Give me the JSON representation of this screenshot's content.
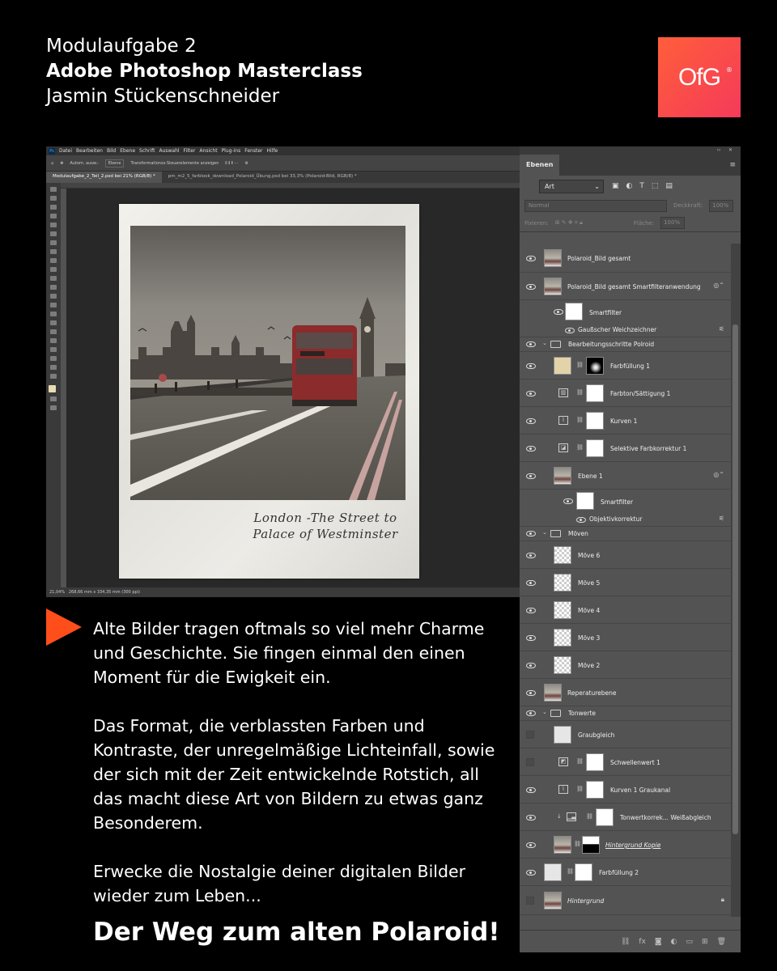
{
  "header": {
    "line1": "Modulaufgabe 2",
    "line2": "Adobe Photoshop Masterclass",
    "line3": "Jasmin Stückenschneider"
  },
  "logo": {
    "text": "OfG",
    "mark": "®",
    "color_start": "#ff5e3a",
    "color_end": "#f53a5a"
  },
  "photoshop": {
    "menu": [
      "Datei",
      "Bearbeiten",
      "Bild",
      "Ebene",
      "Schrift",
      "Auswahl",
      "Filter",
      "Ansicht",
      "Plug-ins",
      "Fenster",
      "Hilfe"
    ],
    "options": {
      "auto_select": "Autom. ausw.:",
      "auto_select_value": "Ebene",
      "transform": "Transformationss-Steuerelemente anzeigen"
    },
    "tabs": [
      "Modulaufgabe_2_Teil_2.psd bei 21% (RGB/8) *",
      "pm_m2_5_farblook_download_Polaroid_Übung.psd bei 33,3% (Polaroid-Bild, RGB/8) *"
    ],
    "status": {
      "zoom": "21,04%",
      "dimensions": "268,66 mm x 334,35 mm (300 ppi)"
    },
    "caption_line1": "London -The Street to",
    "caption_line2": "Palace of Westminster"
  },
  "body": {
    "p1": "Alte Bilder tragen oftmals so viel mehr Charme und Geschichte. Sie fingen einmal den einen Moment für die Ewigkeit ein.",
    "p2": "Das Format, die verblassten Farben und Kontraste, der unregelmäßige Lichteinfall, sowie der sich mit der Zeit entwickelnde Rotstich, all das macht diese Art von Bildern zu etwas ganz Besonderem.",
    "p3": "Erwecke die Nostalgie deiner digitalen Bilder wieder zum Leben...",
    "cta": "Der Weg zum alten Polaroid!",
    "accent": "#ff4e1a"
  },
  "layers_panel": {
    "tab": "Ebenen",
    "filter_kind": "Art",
    "blend_mode": "Normal",
    "opacity_label": "Deckkraft:",
    "opacity": "100%",
    "lock_label": "Fixieren:",
    "fill_label": "Fläche:",
    "fill": "100%",
    "layers": [
      {
        "name": "Polaroid_Bild gesamt"
      },
      {
        "name": "Polaroid_Bild gesamt Smartfilteranwendung"
      },
      {
        "name": "Smartfilter"
      },
      {
        "name": "Gaußscher Weichzeichner"
      },
      {
        "name": "Bearbeitungsschritte Polroid"
      },
      {
        "name": "Farbfüllung 1"
      },
      {
        "name": "Farbton/Sättigung 1"
      },
      {
        "name": "Kurven 1"
      },
      {
        "name": "Selektive Farbkorrektur 1"
      },
      {
        "name": "Ebene 1"
      },
      {
        "name": "Smartfilter"
      },
      {
        "name": "Objektivkorrektur"
      },
      {
        "name": "Möven"
      },
      {
        "name": "Möve 6"
      },
      {
        "name": "Möve 5"
      },
      {
        "name": "Möve 4"
      },
      {
        "name": "Möve 3"
      },
      {
        "name": "Möve 2"
      },
      {
        "name": "Reperaturebene"
      },
      {
        "name": "Tonwerte"
      },
      {
        "name": "Graubgleich"
      },
      {
        "name": "Schwellenwert 1"
      },
      {
        "name": "Kurven 1 Graukanal"
      },
      {
        "name": "Tonwertkorrek... Weißabgleich"
      },
      {
        "name": "Hintergrund Kopie"
      },
      {
        "name": "Farbfüllung 2"
      },
      {
        "name": "Hintergrund"
      }
    ]
  }
}
